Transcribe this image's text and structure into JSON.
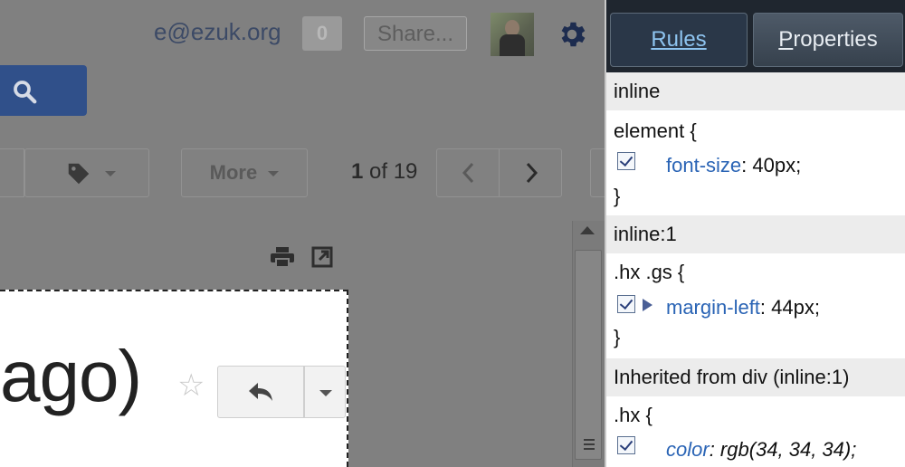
{
  "gmail": {
    "account_email": "e@ezuk.org",
    "notification_count": "0",
    "share_label": "Share...",
    "toolbar": {
      "more_label": "More",
      "pager_current": "1",
      "pager_rest": " of 19"
    },
    "message": {
      "subject_visible": "ago)"
    }
  },
  "devtools": {
    "tabs": {
      "rules": "Rules",
      "properties_first": "P",
      "properties_rest": "roperties"
    },
    "rules": [
      {
        "header": "inline",
        "selector": "element {",
        "property": "font-size",
        "value": "40px;",
        "close": "}"
      },
      {
        "header": "inline:1",
        "selector": ".hx .gs {",
        "property": "margin-left",
        "value": "44px;",
        "close": "}"
      },
      {
        "header": "Inherited from div (inline:1)",
        "selector": ".hx {",
        "property": "color",
        "value": "rgb(34, 34, 34);"
      }
    ]
  }
}
